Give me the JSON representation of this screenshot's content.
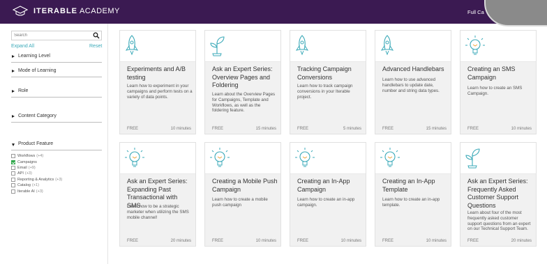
{
  "header": {
    "logo_bold": "ITERABLE",
    "logo_light": "ACADEMY",
    "nav_link": "Full Ca"
  },
  "sidebar": {
    "search_placeholder": "Search",
    "expand_all": "Expand All",
    "reset": "Reset",
    "filters": [
      {
        "label": "Learning Level",
        "expanded": false
      },
      {
        "label": "Mode of Learning",
        "expanded": false
      },
      {
        "label": "Role",
        "expanded": false
      },
      {
        "label": "Content Category",
        "expanded": false
      },
      {
        "label": "Product Feature",
        "expanded": true
      }
    ],
    "product_feature_options": [
      {
        "label": "Workflows",
        "count": "(+4)",
        "checked": false
      },
      {
        "label": "Campaigns",
        "count": "",
        "checked": true
      },
      {
        "label": "Email",
        "count": "(+9)",
        "checked": false
      },
      {
        "label": "API",
        "count": "(+3)",
        "checked": false
      },
      {
        "label": "Reporting & Analytics",
        "count": "(+3)",
        "checked": false
      },
      {
        "label": "Catalog",
        "count": "(+1)",
        "checked": false
      },
      {
        "label": "Iterable AI",
        "count": "(+3)",
        "checked": false
      }
    ]
  },
  "cards": [
    {
      "icon": "rocket-icon",
      "title": "Experiments and A/B testing",
      "description": "Learn how to experiment in your campaigns and perform tests on a variety of data points.",
      "price": "FREE",
      "duration": "10 minutes"
    },
    {
      "icon": "plant-icon",
      "title": "Ask an Expert Series: Overview Pages and Foldering",
      "description": "Learn about the Overview Pages for Campaigns, Template and Workflows, as well as the foldering feature.",
      "price": "FREE",
      "duration": "15 minutes"
    },
    {
      "icon": "rocket-icon",
      "title": "Tracking Campaign Conversions",
      "description": "Learn how to track campaign conversions in your Iterable project.",
      "price": "FREE",
      "duration": "5 minutes"
    },
    {
      "icon": "rocket-icon",
      "title": "Advanced Handlebars",
      "description": "Learn how to use advanced handlebars to update date, number and string data types.",
      "price": "FREE",
      "duration": "15 minutes"
    },
    {
      "icon": "lightbulb-icon",
      "title": "Creating an SMS Campaign",
      "description": "Learn how to create an SMS Campaign.",
      "price": "FREE",
      "duration": "10 minutes"
    },
    {
      "icon": "lightbulb-icon",
      "title": "Ask an Expert Series: Expanding Past Transactional with SMS",
      "description": "Learn how to be a strategic marketer when utilizing the SMS mobile channel!",
      "price": "FREE",
      "duration": "20 minutes"
    },
    {
      "icon": "lightbulb-icon",
      "title": "Creating a Mobile Push Campaign",
      "description": "Learn how to create a mobile push campaign",
      "price": "FREE",
      "duration": "10 minutes"
    },
    {
      "icon": "lightbulb-icon",
      "title": "Creating an In-App Campaign",
      "description": "Learn how to create an in-app campaign.",
      "price": "FREE",
      "duration": "10 minutes"
    },
    {
      "icon": "lightbulb-icon",
      "title": "Creating an In-App Template",
      "description": "Learn how to create an in-app template.",
      "price": "FREE",
      "duration": "10 minutes"
    },
    {
      "icon": "plant-icon",
      "title": "Ask an Expert Series: Frequently Asked Customer Support Questions",
      "description": "Learn about four of the most frequently asked customer support questions from an expert on our Technical Support Team.",
      "price": "FREE",
      "duration": "20 minutes"
    }
  ],
  "colors": {
    "header_bg": "#3b1a52",
    "accent": "#3aa9b8",
    "checkbox_checked": "#2fa64a"
  }
}
